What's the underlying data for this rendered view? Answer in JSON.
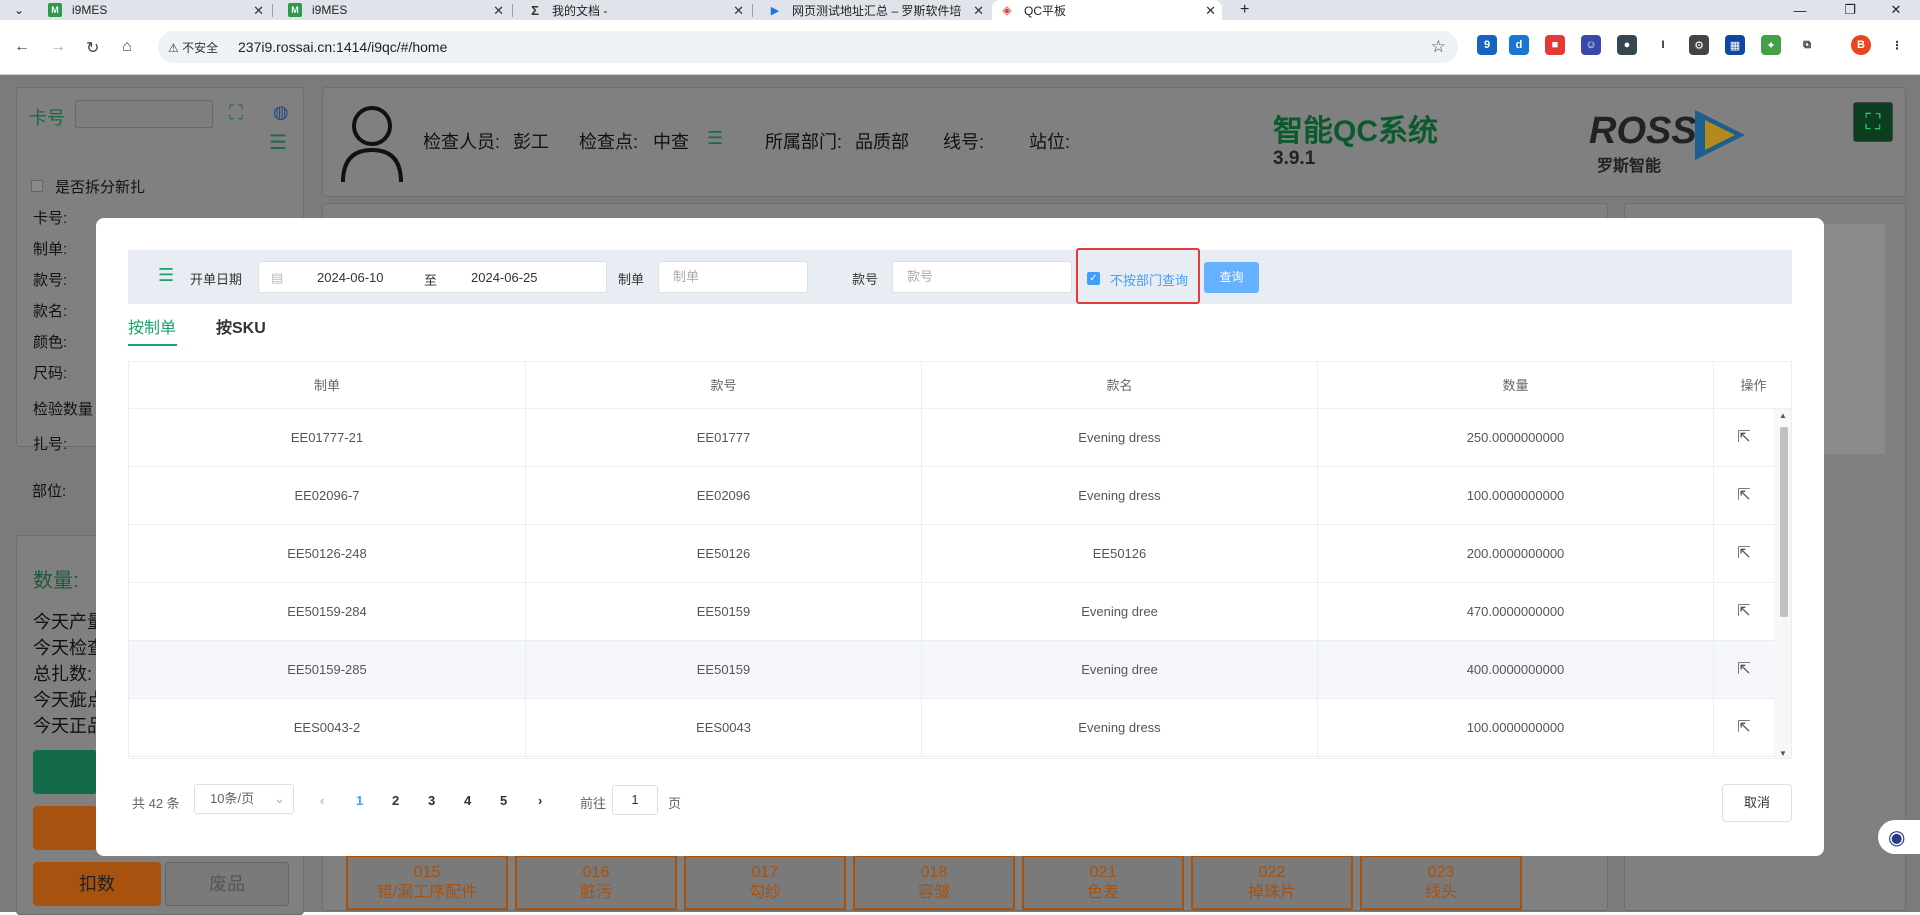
{
  "browser": {
    "tabs": [
      {
        "title": "i9MES",
        "icon": "m-icon",
        "color": "#2e9a4a"
      },
      {
        "title": "i9MES",
        "icon": "m-icon",
        "color": "#2e9a4a"
      },
      {
        "title": "我的文档 -",
        "icon": "sigma-icon",
        "color": "#333333"
      },
      {
        "title": "网页测试地址汇总 – 罗斯软件培",
        "icon": "play-icon",
        "color": "#1a73e8"
      },
      {
        "title": "QC平板",
        "icon": "qc-icon",
        "color": "#e23a3a"
      }
    ],
    "security_label": "不安全",
    "url": "237i9.rossai.cn:1414/i9qc/#/home",
    "ext_badge": "9",
    "profile_initial": "B"
  },
  "left_panel": {
    "card_label": "卡号",
    "split_checkbox_label": "是否拆分新扎",
    "fields": [
      "卡号:",
      "制单:",
      "款号:",
      "款名:",
      "颜色:",
      "尺码:",
      "检验数量",
      "扎号:",
      "部位:"
    ],
    "qty_title": "数量:",
    "qty_lines": [
      "今天产量",
      "今天检查",
      "总扎数:",
      "今天疵点",
      "今天正品"
    ],
    "buttons": {
      "deduct": "扣数",
      "scrap": "废品"
    }
  },
  "header": {
    "inspector_label": "检查人员:",
    "inspector": "彭工",
    "checkpoint_label": "检查点:",
    "checkpoint": "中查",
    "dept_label": "所属部门:",
    "dept": "品质部",
    "line_label": "线号:",
    "station_label": "站位:",
    "system_title": "智能QC系统",
    "version": "3.9.1",
    "logo_text": "ROSS",
    "logo_sub": "罗斯智能"
  },
  "defects": [
    {
      "code": "015",
      "name": "错/漏工序配件"
    },
    {
      "code": "016",
      "name": "脏污"
    },
    {
      "code": "017",
      "name": "勾纱"
    },
    {
      "code": "018",
      "name": "容皱"
    },
    {
      "code": "021",
      "name": "色差"
    },
    {
      "code": "022",
      "name": "掉珠片"
    },
    {
      "code": "023",
      "name": "线头"
    }
  ],
  "modal": {
    "filter": {
      "date_label": "开单日期",
      "date_start": "2024-06-10",
      "date_sep": "至",
      "date_end": "2024-06-25",
      "order_label": "制单",
      "order_placeholder": "制单",
      "style_label": "款号",
      "style_placeholder": "款号",
      "no_dept_label": "不按部门查询",
      "query_button": "查询"
    },
    "tabs": [
      "按制单",
      "按SKU"
    ],
    "columns": [
      "制单",
      "款号",
      "款名",
      "数量",
      "操作"
    ],
    "rows": [
      {
        "order": "EE01777-21",
        "style": "EE01777",
        "name": "Evening dress",
        "qty": "250.0000000000"
      },
      {
        "order": "EE02096-7",
        "style": "EE02096",
        "name": "Evening dress",
        "qty": "100.0000000000"
      },
      {
        "order": "EE50126-248",
        "style": "EE50126",
        "name": "EE50126",
        "qty": "200.0000000000"
      },
      {
        "order": "EE50159-284",
        "style": "EE50159",
        "name": "Evening dree",
        "qty": "470.0000000000"
      },
      {
        "order": "EE50159-285",
        "style": "EE50159",
        "name": "Evening dree",
        "qty": "400.0000000000"
      },
      {
        "order": "EES0043-2",
        "style": "EES0043",
        "name": "Evening dress",
        "qty": "100.0000000000"
      }
    ],
    "pagination": {
      "total": "共 42 条",
      "page_size": "10条/页",
      "pages": [
        "1",
        "2",
        "3",
        "4",
        "5"
      ],
      "current_page": "1",
      "goto_label": "前往",
      "goto_value": "1",
      "page_suffix": "页"
    },
    "cancel_button": "取消"
  },
  "colors": {
    "accent_green": "#1aa36a",
    "primary_blue": "#409eff",
    "highlight_red": "#e23a3a",
    "orange": "#e07a1f"
  }
}
